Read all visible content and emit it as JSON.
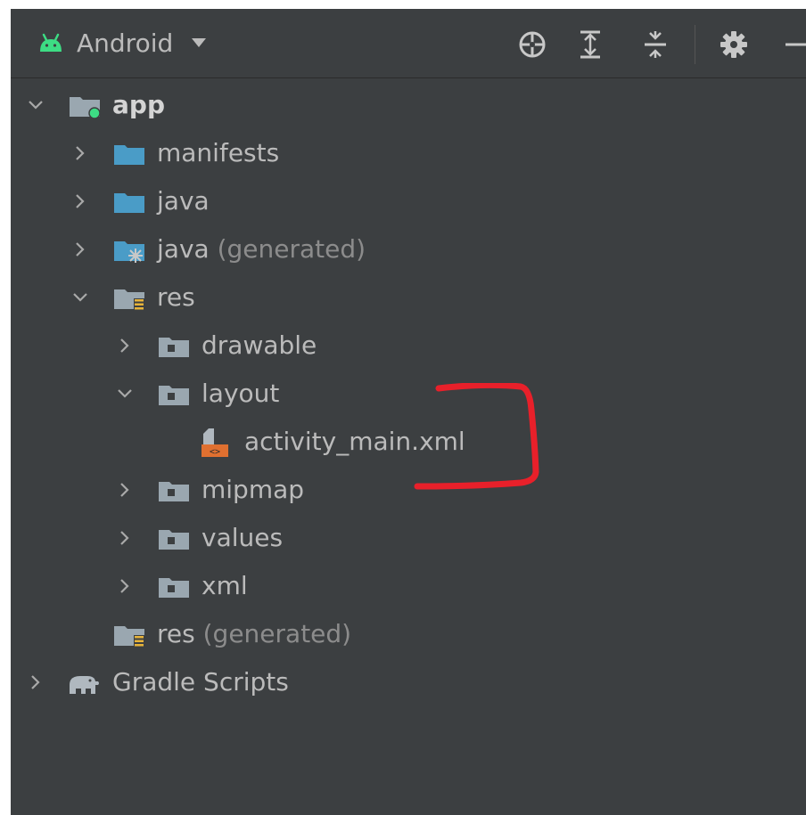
{
  "toolbar": {
    "view_label": "Android",
    "icons": [
      "locate-icon",
      "expand-all-icon",
      "collapse-all-icon",
      "settings-icon",
      "hide-icon"
    ]
  },
  "tree": {
    "app": {
      "label": "app"
    },
    "manifests": {
      "label": "manifests"
    },
    "java": {
      "label": "java"
    },
    "java_generated": {
      "label": "java",
      "suffix": "(generated)"
    },
    "res": {
      "label": "res"
    },
    "drawable": {
      "label": "drawable"
    },
    "layout": {
      "label": "layout"
    },
    "activity_main": {
      "label": "activity_main.xml"
    },
    "mipmap": {
      "label": "mipmap"
    },
    "values": {
      "label": "values"
    },
    "xml": {
      "label": "xml"
    },
    "res_generated": {
      "label": "res",
      "suffix": "(generated)"
    },
    "gradle": {
      "label": "Gradle Scripts"
    }
  },
  "colors": {
    "panel_bg": "#3c3f41",
    "text": "#bbbbbb",
    "muted_text": "#8c8c8c",
    "android_green": "#3ddc84",
    "folder_blue": "#4a9cc7",
    "annotation_red": "#e8202a",
    "xml_orange": "#e07030"
  }
}
